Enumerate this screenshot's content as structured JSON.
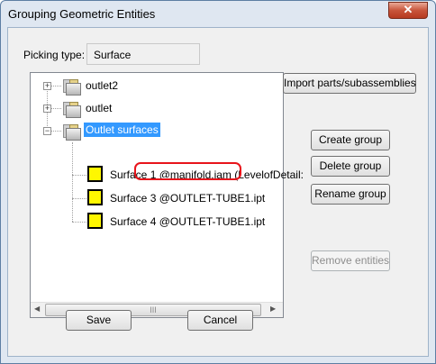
{
  "window": {
    "title": "Grouping Geometric Entities",
    "close_glyph": "✕"
  },
  "picking": {
    "label": "Picking type:",
    "value": "Surface"
  },
  "tree": {
    "nodes": [
      {
        "label": "outlet2",
        "expander": "+",
        "icon": "assembly-folder-icon"
      },
      {
        "label": "outlet",
        "expander": "+",
        "icon": "assembly-folder-icon"
      },
      {
        "label": "Outlet surfaces",
        "expander": "−",
        "icon": "assembly-folder-icon",
        "selected": true
      }
    ],
    "children": [
      {
        "label": "Surface 1 @manifold.iam (LevelofDetail:",
        "icon": "surface-icon"
      },
      {
        "label": "Surface 3 @OUTLET-TUBE1.ipt",
        "icon": "surface-icon"
      },
      {
        "label": "Surface 4 @OUTLET-TUBE1.ipt",
        "icon": "surface-icon"
      }
    ],
    "scroll_left": "◀",
    "scroll_right": "▶",
    "scroll_thumb_grip": "III"
  },
  "buttons": {
    "import": "Import parts/subassemblies",
    "create_group": "Create group",
    "delete_group": "Delete group",
    "rename_group": "Rename group",
    "remove_entities": "Remove entities",
    "save": "Save",
    "cancel": "Cancel"
  },
  "colors": {
    "selection": "#3399ff",
    "annotation_ring": "#e8141b",
    "surface_fill": "#fff700"
  }
}
